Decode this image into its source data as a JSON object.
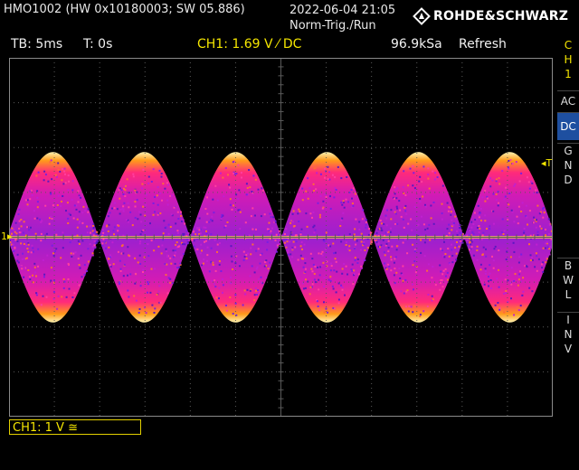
{
  "header": {
    "device": "HMO1002 (HW 0x10180003; SW 05.886)",
    "date": "2022-06-04 21:05",
    "trigger_mode": "Norm-Trig./Run",
    "brand": "ROHDE&SCHWARZ"
  },
  "status_bar": {
    "timebase": "TB: 5ms",
    "trigger_time": "T: 0s",
    "trigger_info": "CH1: 1.69 V ⁄ DC",
    "sample_rate": "96.9kSa",
    "acquisition": "Refresh"
  },
  "side_menu": {
    "channel_label": "C\nH\n1",
    "ac": "AC",
    "dc": "DC",
    "gnd": "G\nN\nD",
    "bwl": "B\nW\nL",
    "inv": "I\nN\nV"
  },
  "markers": {
    "ground": "1",
    "trigger_level": "T"
  },
  "footer": {
    "channel_scale": "CH1: 1 V ≅"
  },
  "colors": {
    "trace_yellow": "#f5e600",
    "dc_selected": "#1e4fa0",
    "grid": "#5a5a5a"
  },
  "waveform": {
    "description_type": "am-envelope-persistence",
    "envelope_periods_visible": 6,
    "center_volts": 0,
    "peak_volts": 1.9
  }
}
